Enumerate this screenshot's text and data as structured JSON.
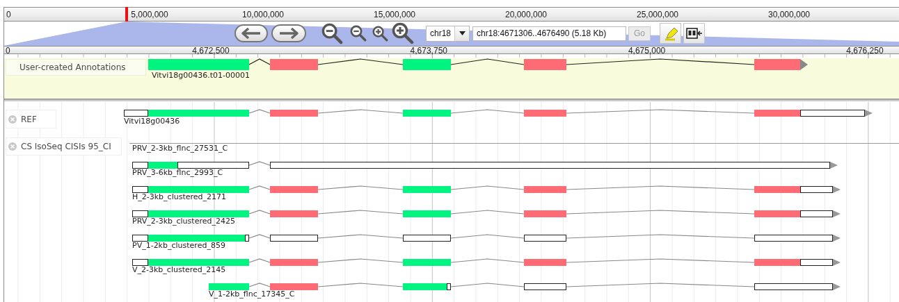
{
  "overview_ruler": {
    "ticks": [
      "0",
      "5,000,000",
      "10,000,000",
      "15,000,000",
      "20,000,000",
      "25,000,000",
      "30,000,000"
    ]
  },
  "toolbar": {
    "reference_select": {
      "value": "chr18"
    },
    "location_field": {
      "value": "chr18:4671306..4676490 (5.18 Kb)"
    },
    "go_button": {
      "label": "Go",
      "disabled": true
    }
  },
  "detail_ruler": {
    "ticks": [
      "0",
      "4,672,500",
      "4,673,750",
      "4,675,000",
      "4,676,250"
    ]
  },
  "tracks": [
    {
      "kind": "annotations",
      "label": "User-created Annotations",
      "closable": false,
      "features": [
        {
          "label": "Vitvi18g00436.t01-00001",
          "blocks": [
            [
              {
                "kind": "cds",
                "color": "#00f480"
              }
            ],
            [
              {
                "kind": "cds",
                "color": "#ff6b75"
              }
            ],
            [
              {
                "kind": "cds",
                "color": "#00f480"
              }
            ],
            [
              {
                "kind": "cds",
                "color": "#ff6b75"
              }
            ],
            [
              {
                "kind": "cds",
                "color": "#ff6b75"
              }
            ]
          ]
        }
      ]
    },
    {
      "kind": "reference",
      "label": "REF",
      "closable": true,
      "features": [
        {
          "label": "Vitvi18g00436",
          "blocks": [
            [
              {
                "kind": "utr"
              },
              {
                "kind": "cds",
                "color": "#00f480"
              }
            ],
            [
              {
                "kind": "cds",
                "color": "#ff6b75"
              }
            ],
            [
              {
                "kind": "cds",
                "color": "#00f480"
              }
            ],
            [
              {
                "kind": "cds",
                "color": "#ff6b75"
              }
            ],
            [
              {
                "kind": "cds",
                "color": "#ff6b75"
              },
              {
                "kind": "utr"
              }
            ]
          ]
        }
      ]
    },
    {
      "kind": "alignments",
      "label": "CS IsoSeq CISIs 95_CI",
      "closable": true,
      "features": [
        {
          "label": "PRV_2-3kb_flnc_27531_C"
        },
        {
          "label": "PRV_3-6kb_flnc_2993_C",
          "blocks": [
            [
              {
                "kind": "utr"
              },
              {
                "kind": "cds",
                "color": "#00f480"
              },
              {
                "kind": "utr"
              }
            ],
            [
              {
                "kind": "utr"
              }
            ]
          ]
        },
        {
          "label": "H_2-3kb_clustered_2171",
          "blocks": [
            [
              {
                "kind": "utr"
              },
              {
                "kind": "cds",
                "color": "#00f480"
              }
            ],
            [
              {
                "kind": "cds",
                "color": "#ff6b75"
              }
            ],
            [
              {
                "kind": "cds",
                "color": "#00f480"
              }
            ],
            [
              {
                "kind": "cds",
                "color": "#ff6b75"
              }
            ],
            [
              {
                "kind": "cds",
                "color": "#ff6b75"
              },
              {
                "kind": "utr"
              }
            ]
          ]
        },
        {
          "label": "PRV_2-3kb_clustered_2425",
          "blocks": [
            [
              {
                "kind": "utr"
              },
              {
                "kind": "cds",
                "color": "#00f480"
              }
            ],
            [
              {
                "kind": "cds",
                "color": "#ff6b75"
              }
            ],
            [
              {
                "kind": "cds",
                "color": "#00f480"
              }
            ],
            [
              {
                "kind": "cds",
                "color": "#ff6b75"
              }
            ],
            [
              {
                "kind": "cds",
                "color": "#ff6b75"
              },
              {
                "kind": "utr"
              }
            ]
          ]
        },
        {
          "label": "PV_1-2kb_clustered_859",
          "blocks": [
            [
              {
                "kind": "utr"
              },
              {
                "kind": "cds",
                "color": "#00f480"
              },
              {
                "kind": "utr"
              }
            ],
            [
              {
                "kind": "utr"
              }
            ],
            [
              {
                "kind": "utr"
              }
            ],
            [
              {
                "kind": "utr"
              }
            ],
            [
              {
                "kind": "utr"
              }
            ]
          ]
        },
        {
          "label": "V_2-3kb_clustered_2145",
          "blocks": [
            [
              {
                "kind": "utr"
              },
              {
                "kind": "cds",
                "color": "#00f480"
              }
            ],
            [
              {
                "kind": "cds",
                "color": "#ff6b75"
              }
            ],
            [
              {
                "kind": "cds",
                "color": "#00f480"
              }
            ],
            [
              {
                "kind": "cds",
                "color": "#ff6b75"
              }
            ],
            [
              {
                "kind": "cds",
                "color": "#ff6b75"
              },
              {
                "kind": "utr"
              }
            ]
          ]
        },
        {
          "label": "V_1-2kb_flnc_17345_C",
          "blocks": [
            [
              {
                "kind": "cds",
                "color": "#00f480"
              }
            ],
            [
              {
                "kind": "cds",
                "color": "#ff6b75"
              }
            ],
            [
              {
                "kind": "cds",
                "color": "#00f480"
              },
              {
                "kind": "utr"
              }
            ],
            [
              {
                "kind": "utr"
              }
            ],
            [
              {
                "kind": "utr"
              }
            ]
          ]
        }
      ]
    }
  ]
}
